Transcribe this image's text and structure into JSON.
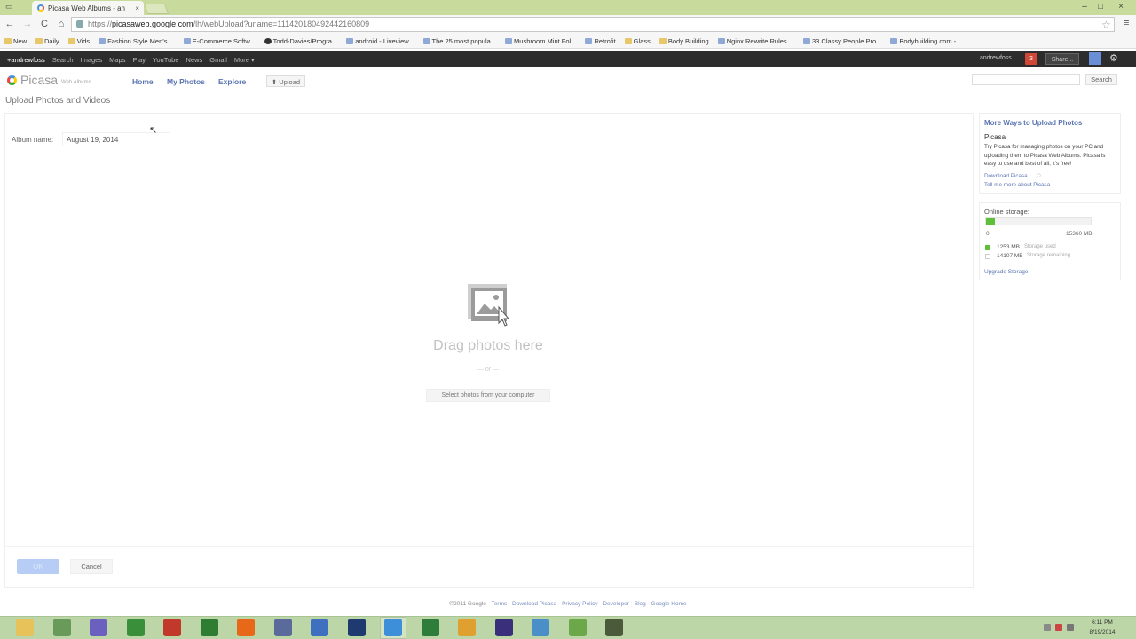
{
  "browser": {
    "tab_title": "Picasa Web Albums - an",
    "tab_close": "×",
    "url_scheme": "https://",
    "url_host": "picasaweb.google.com",
    "url_path": "/lh/webUpload?uname=111420180492442160809",
    "window_controls": [
      "–",
      "□",
      "×"
    ],
    "star": "☆",
    "menu": "≡",
    "nav": {
      "back": "←",
      "forward": "→",
      "reload": "C",
      "home": "⌂"
    }
  },
  "bookmarks": [
    {
      "label": "New",
      "icon": "folder-icon"
    },
    {
      "label": "Daily",
      "icon": "folder-icon"
    },
    {
      "label": "Vids",
      "icon": "folder-icon"
    },
    {
      "label": "Fashion Style Men's ...",
      "icon": "page-icon"
    },
    {
      "label": "E-Commerce Softw...",
      "icon": "page-icon"
    },
    {
      "label": "Todd-Davies/Progra...",
      "icon": "github-icon"
    },
    {
      "label": "android - Liveview...",
      "icon": "page-icon"
    },
    {
      "label": "The 25 most popula...",
      "icon": "page-icon"
    },
    {
      "label": "Mushroom Mint Fol...",
      "icon": "page-icon"
    },
    {
      "label": "Retrofit",
      "icon": "page-icon"
    },
    {
      "label": "Glass",
      "icon": "folder-icon"
    },
    {
      "label": "Body Building",
      "icon": "folder-icon"
    },
    {
      "label": "Nginx Rewrite Rules ...",
      "icon": "page-icon"
    },
    {
      "label": "33 Classy People Pro...",
      "icon": "page-icon"
    },
    {
      "label": "Bodybuilding.com - ...",
      "icon": "page-icon"
    }
  ],
  "gbar": {
    "items": [
      "+andrewfoss",
      "Search",
      "Images",
      "Maps",
      "Play",
      "YouTube",
      "News",
      "Gmail",
      "More ▾"
    ],
    "user": "andrewfoss",
    "notifications": "3",
    "share": "Share...",
    "gear": "⚙"
  },
  "picasa": {
    "logo_word": "Picasa",
    "logo_sub": "Web Albums",
    "tabs": [
      "Home",
      "My Photos",
      "Explore"
    ],
    "upload_label": "⬆ Upload",
    "search_value": "",
    "search_label": "Search"
  },
  "upload": {
    "page_title": "Upload Photos and Videos",
    "album_label": "Album name:",
    "album_value": "August 19, 2014",
    "drag_text": "Drag photos here",
    "or_text": "— or —",
    "select_label": "Select photos from your computer",
    "ok_label": "OK",
    "cancel_label": "Cancel"
  },
  "sidebar": {
    "title": "More Ways to Upload Photos",
    "subtitle": "Picasa",
    "desc": "Try Picasa for managing photos on your PC and uploading them to Picasa Web Albums. Picasa is easy to use and best of all, it's free!",
    "link_download": "Download Picasa",
    "link_more": "Tell me more about Picasa"
  },
  "storage": {
    "title": "Online storage:",
    "min": "0",
    "max": "15360 MB",
    "used_value": "1253 MB",
    "used_label": "Storage used",
    "remaining_value": "14107 MB",
    "remaining_label": "Storage remaining",
    "used_fraction": 0.082,
    "upgrade": "Upgrade Storage",
    "used_color": "#5fbf3a"
  },
  "footer": {
    "copyright": "©2011 Google",
    "links": [
      "Terms",
      "Download Picasa",
      "Privacy Policy",
      "Developer",
      "Blog",
      "Google Home"
    ],
    "sep": " - "
  },
  "taskbar": {
    "apps": [
      {
        "name": "windows-explorer-icon",
        "color": "#e7c15a"
      },
      {
        "name": "computer-icon",
        "color": "#6a9a5a"
      },
      {
        "name": "orb-icon",
        "color": "#6b5fbf"
      },
      {
        "name": "notepad-icon",
        "color": "#3a8f3a"
      },
      {
        "name": "filezilla-icon",
        "color": "#c0392b"
      },
      {
        "name": "network-icon",
        "color": "#2e7d32"
      },
      {
        "name": "firefox-icon",
        "color": "#e8681a"
      },
      {
        "name": "putty-icon",
        "color": "#5a6a9a"
      },
      {
        "name": "virtualbox-icon",
        "color": "#3f6fbf"
      },
      {
        "name": "photoshop-icon",
        "color": "#1e3a6e"
      },
      {
        "name": "chrome-icon",
        "color": "#3c8fd8"
      },
      {
        "name": "excel-icon",
        "color": "#2f7d3a"
      },
      {
        "name": "media-player-icon",
        "color": "#e0a030"
      },
      {
        "name": "eclipse-icon",
        "color": "#3a2f7a"
      },
      {
        "name": "remote-desktop-icon",
        "color": "#4a8fc8"
      },
      {
        "name": "android-studio-icon",
        "color": "#6ca84a"
      },
      {
        "name": "tools-icon",
        "color": "#4a5a3a"
      }
    ],
    "time": "6:11 PM",
    "date": "8/19/2014"
  }
}
